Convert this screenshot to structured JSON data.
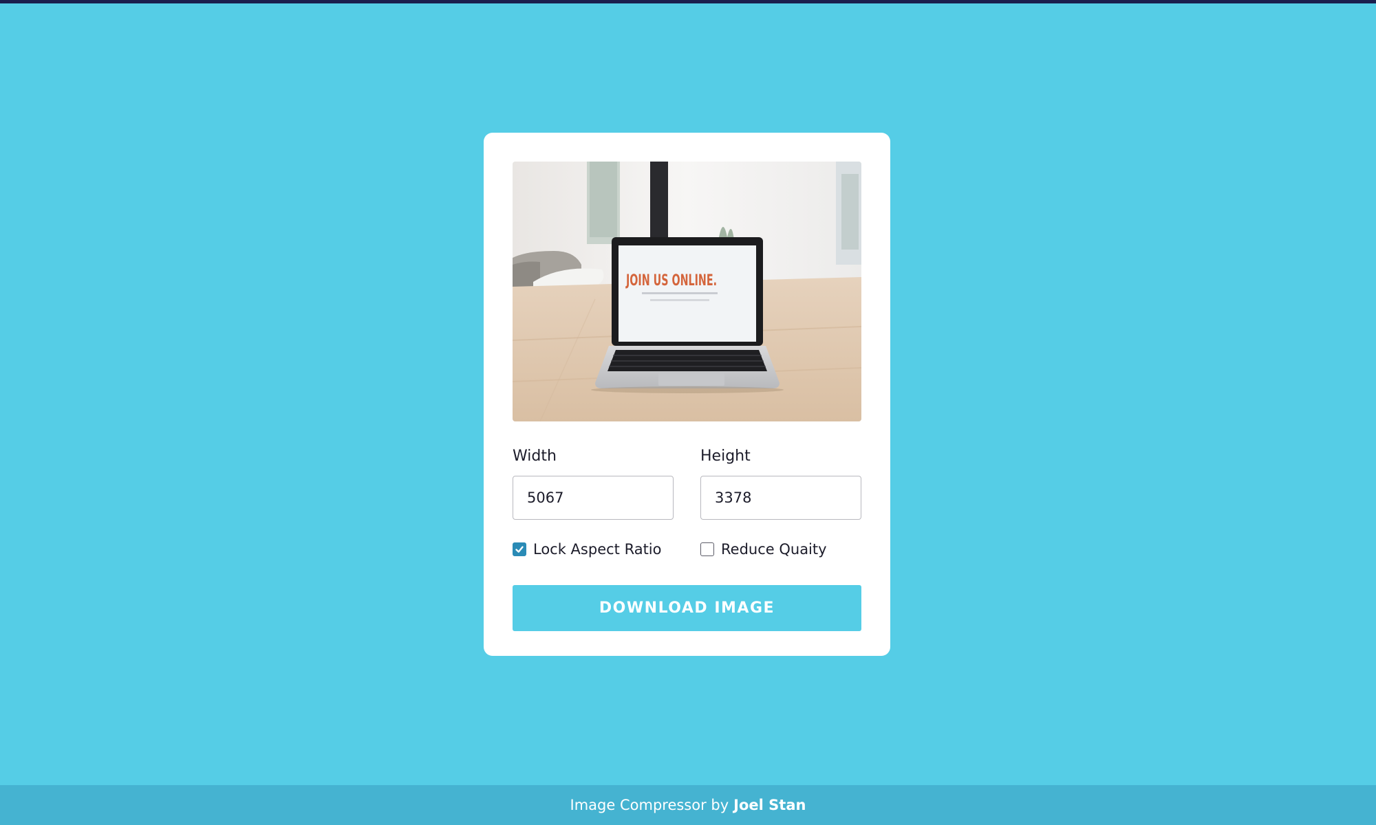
{
  "preview": {
    "screen_text": "JOIN US ONLINE."
  },
  "form": {
    "width_label": "Width",
    "width_value": "5067",
    "height_label": "Height",
    "height_value": "3378",
    "lock_aspect_label": "Lock Aspect Ratio",
    "lock_aspect_checked": true,
    "reduce_quality_label": "Reduce Quaity",
    "reduce_quality_checked": false
  },
  "actions": {
    "download_label": "DOWNLOAD IMAGE"
  },
  "footer": {
    "text": "Image Compressor by",
    "author": "Joel Stan"
  },
  "colors": {
    "background": "#55cde6",
    "accent": "#2a8bb6",
    "footer": "#45b3d1"
  }
}
